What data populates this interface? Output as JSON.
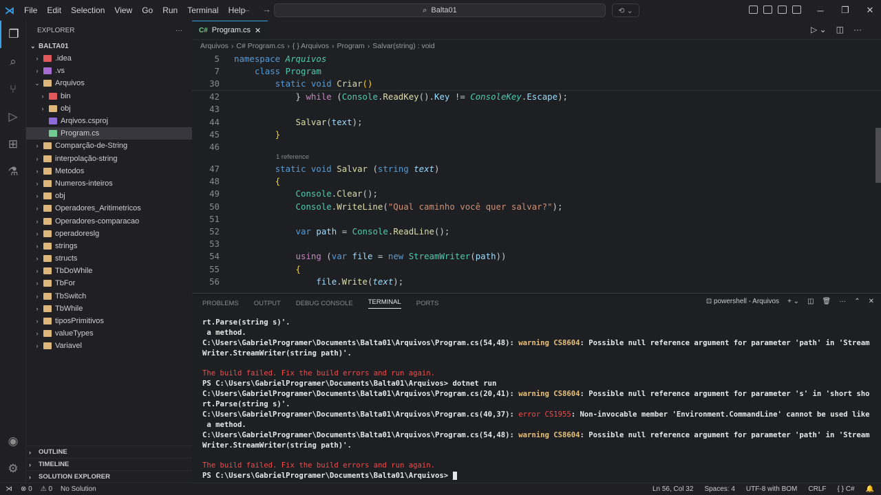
{
  "menu": [
    "File",
    "Edit",
    "Selection",
    "View",
    "Go",
    "Run",
    "Terminal",
    "Help"
  ],
  "search": {
    "text": "Balta01"
  },
  "explorer": {
    "title": "EXPLORER",
    "root": "BALTA01",
    "items": [
      {
        "label": ".idea",
        "depth": 1,
        "chev": "›",
        "color": "#e0585c"
      },
      {
        "label": ".vs",
        "depth": 1,
        "chev": "›",
        "color": "#a66bd1"
      },
      {
        "label": "Arquivos",
        "depth": 1,
        "chev": "⌄",
        "color": "#dcb67a"
      },
      {
        "label": "bin",
        "depth": 2,
        "chev": "›",
        "color": "#e0585c"
      },
      {
        "label": "obj",
        "depth": 2,
        "chev": "›",
        "color": "#dcb67a"
      },
      {
        "label": "Arqivos.csproj",
        "depth": 2,
        "chev": "",
        "color": "#8e6cd8"
      },
      {
        "label": "Program.cs",
        "depth": 2,
        "chev": "",
        "color": "#73c991",
        "selected": true
      },
      {
        "label": "Comparção-de-String",
        "depth": 1,
        "chev": "›",
        "color": "#dcb67a"
      },
      {
        "label": "interpolação-string",
        "depth": 1,
        "chev": "›",
        "color": "#dcb67a"
      },
      {
        "label": "Metodos",
        "depth": 1,
        "chev": "›",
        "color": "#dcb67a"
      },
      {
        "label": "Numeros-inteiros",
        "depth": 1,
        "chev": "›",
        "color": "#dcb67a"
      },
      {
        "label": "obj",
        "depth": 1,
        "chev": "›",
        "color": "#dcb67a"
      },
      {
        "label": "Operadores_Aritimetricos",
        "depth": 1,
        "chev": "›",
        "color": "#dcb67a"
      },
      {
        "label": "Operadores-comparacao",
        "depth": 1,
        "chev": "›",
        "color": "#dcb67a"
      },
      {
        "label": "operadoreslg",
        "depth": 1,
        "chev": "›",
        "color": "#dcb67a"
      },
      {
        "label": "strings",
        "depth": 1,
        "chev": "›",
        "color": "#dcb67a"
      },
      {
        "label": "structs",
        "depth": 1,
        "chev": "›",
        "color": "#dcb67a"
      },
      {
        "label": "TbDoWhile",
        "depth": 1,
        "chev": "›",
        "color": "#dcb67a"
      },
      {
        "label": "TbFor",
        "depth": 1,
        "chev": "›",
        "color": "#dcb67a"
      },
      {
        "label": "TbSwitch",
        "depth": 1,
        "chev": "›",
        "color": "#dcb67a"
      },
      {
        "label": "TbWhile",
        "depth": 1,
        "chev": "›",
        "color": "#dcb67a"
      },
      {
        "label": "tiposPrimitivos",
        "depth": 1,
        "chev": "›",
        "color": "#dcb67a"
      },
      {
        "label": "valueTypes",
        "depth": 1,
        "chev": "›",
        "color": "#dcb67a"
      },
      {
        "label": "Variavel",
        "depth": 1,
        "chev": "›",
        "color": "#dcb67a"
      }
    ],
    "sections": [
      "OUTLINE",
      "TIMELINE",
      "SOLUTION EXPLORER"
    ]
  },
  "editor": {
    "tab": "Program.cs",
    "breadcrumbs": [
      "Arquivos",
      "C# Program.cs",
      "{ } Arquivos",
      "Program",
      "Salvar(string) : void"
    ],
    "sticky": [
      {
        "ln": "5",
        "html": "<span class='kw'>namespace</span> <span class='ty it'>Arquivos</span>"
      },
      {
        "ln": "7",
        "html": "    <span class='kw'>class</span> <span class='ty'>Program</span>"
      },
      {
        "ln": "30",
        "html": "        <span class='kw'>static</span> <span class='kw'>void</span> <span class='fn'>Criar</span><span class='br'>()</span>"
      }
    ],
    "lines": [
      {
        "ln": "42",
        "html": "            <span class='pl'>}</span> <span class='kw2'>while</span> <span class='pl'>(</span><span class='ty'>Console</span>.<span class='fn'>ReadKey</span>().<span class='par'>Key</span> != <span class='ty it'>ConsoleKey</span>.<span class='par'>Escape</span>);"
      },
      {
        "ln": "43",
        "html": ""
      },
      {
        "ln": "44",
        "html": "            <span class='fn'>Salvar</span>(<span class='par'>text</span>);"
      },
      {
        "ln": "45",
        "html": "        <span class='br'>}</span>"
      },
      {
        "ln": "46",
        "html": ""
      },
      {
        "lens": "1 reference"
      },
      {
        "ln": "47",
        "html": "        <span class='kw'>static</span> <span class='kw'>void</span> <span class='fn'>Salvar</span> (<span class='kw'>string</span> <span class='par it'>text</span>)"
      },
      {
        "ln": "48",
        "html": "        <span class='br'>{</span>"
      },
      {
        "ln": "49",
        "html": "            <span class='ty'>Console</span>.<span class='fn'>Clear</span>();"
      },
      {
        "ln": "50",
        "html": "            <span class='ty'>Console</span>.<span class='fn'>WriteLine</span>(<span class='st'>\"Qual caminho você quer salvar?\"</span>);"
      },
      {
        "ln": "51",
        "html": ""
      },
      {
        "ln": "52",
        "html": "            <span class='kw'>var</span> <span class='par'>path</span> = <span class='ty'>Console</span>.<span class='fn'>ReadLine</span>();"
      },
      {
        "ln": "53",
        "html": ""
      },
      {
        "ln": "54",
        "html": "            <span class='kw2'>using</span> (<span class='kw'>var</span> <span class='par'>file</span> = <span class='kw'>new</span> <span class='ty'>StreamWriter</span>(<span class='par'>path</span>))"
      },
      {
        "ln": "55",
        "html": "            <span class='br'>{</span>"
      },
      {
        "ln": "56",
        "html": "                <span class='par'>file</span>.<span class='fn'>Write</span>(<span class='par it'>text</span>);"
      }
    ]
  },
  "panel": {
    "tabs": [
      "PROBLEMS",
      "OUTPUT",
      "DEBUG CONSOLE",
      "TERMINAL",
      "PORTS"
    ],
    "active": "TERMINAL",
    "shell": "powershell - Arquivos",
    "lines": [
      {
        "html": "<span class='w'>rt.Parse(string s)'.</span>"
      },
      {
        "html": "<span class='w'> a method.</span>"
      },
      {
        "html": "<span class='w'>C:\\Users\\GabrielProgramer\\Documents\\Balta01\\Arquivos\\Program.cs(54,48): </span><span class='warn'>warning CS8604</span><span class='w'>: Possible null reference argument for parameter 'path' in 'Stream</span>"
      },
      {
        "html": "<span class='w'>Writer.StreamWriter(string path)'.</span>"
      },
      {
        "html": ""
      },
      {
        "html": "<span class='fail'>The build failed. Fix the build errors and run again.</span>"
      },
      {
        "html": "<span class='w'>PS C:\\Users\\GabrielProgramer\\Documents\\Balta01\\Arquivos&gt; dotnet run</span>"
      },
      {
        "html": "<span class='w'>C:\\Users\\GabrielProgramer\\Documents\\Balta01\\Arquivos\\Program.cs(20,41): </span><span class='warn'>warning CS8604</span><span class='w'>: Possible null reference argument for parameter 's' in 'short sho</span>"
      },
      {
        "html": "<span class='w'>rt.Parse(string s)'.</span>"
      },
      {
        "html": "<span class='w'>C:\\Users\\GabrielProgramer\\Documents\\Balta01\\Arquivos\\Program.cs(40,37): </span><span class='err'>error CS1955</span><span class='w'>: Non-invocable member 'Environment.CommandLine' cannot be used like</span>"
      },
      {
        "html": "<span class='w'> a method.</span>"
      },
      {
        "html": "<span class='w'>C:\\Users\\GabrielProgramer\\Documents\\Balta01\\Arquivos\\Program.cs(54,48): </span><span class='warn'>warning CS8604</span><span class='w'>: Possible null reference argument for parameter 'path' in 'Stream</span>"
      },
      {
        "html": "<span class='w'>Writer.StreamWriter(string path)'.</span>"
      },
      {
        "html": ""
      },
      {
        "html": "<span class='fail'>The build failed. Fix the build errors and run again.</span>"
      },
      {
        "html": "<span class='w'>PS C:\\Users\\GabrielProgramer\\Documents\\Balta01\\Arquivos&gt; </span><span style='background:#e6e6e6;color:#e6e6e6'>_</span>"
      }
    ]
  },
  "status": {
    "errors": "⊗ 0",
    "warnings": "⚠ 0",
    "solution": "No Solution",
    "position": "Ln 56, Col 32",
    "spaces": "Spaces: 4",
    "encoding": "UTF-8 with BOM",
    "eol": "CRLF",
    "lang": "C#"
  }
}
